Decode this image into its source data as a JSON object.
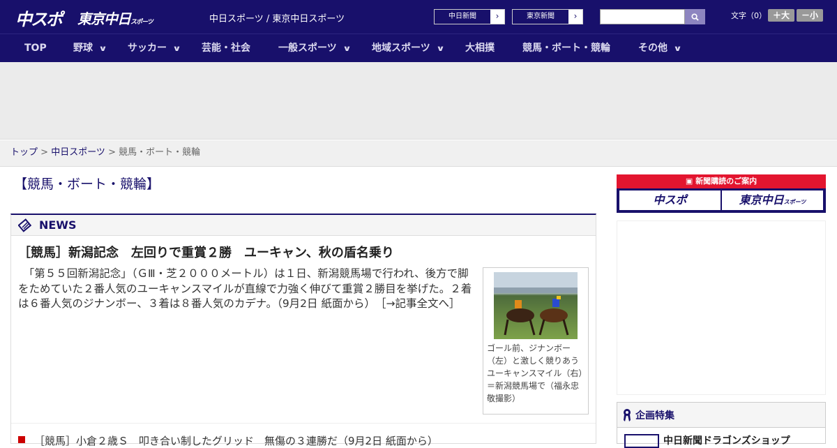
{
  "header": {
    "logo_main": "中スポ",
    "logo_tokyo": "東京中日",
    "logo_tokyo_suffix": "スポーツ",
    "site_links": "中日スポーツ / 東京中日スポーツ",
    "newspaper_buttons": [
      "中日新聞",
      "東京新聞"
    ],
    "search": {
      "value": "",
      "placeholder": ""
    },
    "font_size": {
      "label": "文字（0）",
      "larger": "＋大",
      "smaller": "－小"
    }
  },
  "nav": {
    "items": [
      {
        "label": "TOP",
        "dropdown": false
      },
      {
        "label": "野球",
        "dropdown": true
      },
      {
        "label": "サッカー",
        "dropdown": true
      },
      {
        "label": "芸能・社会",
        "dropdown": false
      },
      {
        "label": "一般スポーツ",
        "dropdown": true
      },
      {
        "label": "地域スポーツ",
        "dropdown": true
      },
      {
        "label": "大相撲",
        "dropdown": false
      },
      {
        "label": "競馬・ボート・競輪",
        "dropdown": false
      },
      {
        "label": "その他",
        "dropdown": true
      }
    ]
  },
  "breadcrumb": {
    "home": "トップ",
    "sep": " > ",
    "section": "中日スポーツ",
    "current": "競馬・ボート・競輪"
  },
  "page": {
    "category_title": "【競馬・ボート・競輪】"
  },
  "news": {
    "header": "NEWS",
    "headline": "［競馬］新潟記念　左回りで重賞２勝　ユーキャン、秋の盾名乗り",
    "body": "　「第５５回新潟記念」（ＧⅢ・芝２０００メートル）は１日、新潟競馬場で行われ、後方で脚をためていた２番人気のユーキャンスマイルが直線で力強く伸びて重賞２勝目を挙げた。２着は６番人気のジナンボー、３着は８番人気のカデナ。（9月2日 紙面から）　［→記事全文へ］",
    "photo_caption": "ゴール前、ジナンボー（左）と激しく競りあうユーキャンスマイル（右）＝新潟競馬場で（福永忠敬撮影）",
    "sub_item": "［競馬］小倉２歳Ｓ　叩き合い制したグリッド　無傷の３連勝だ（9月2日 紙面から）"
  },
  "sidebar": {
    "promo_title": "新聞購読のご案内",
    "promo_buttons": [
      {
        "label": "中スポ",
        "suffix": ""
      },
      {
        "label": "東京中日",
        "suffix": "スポーツ"
      }
    ],
    "feature_title": "企画特集",
    "feature_item": "中日新聞ドラゴンズショップ"
  },
  "colors": {
    "brand_navy": "#18106b",
    "accent_red": "#e3152f",
    "nav_text": "#dcdaf0"
  }
}
